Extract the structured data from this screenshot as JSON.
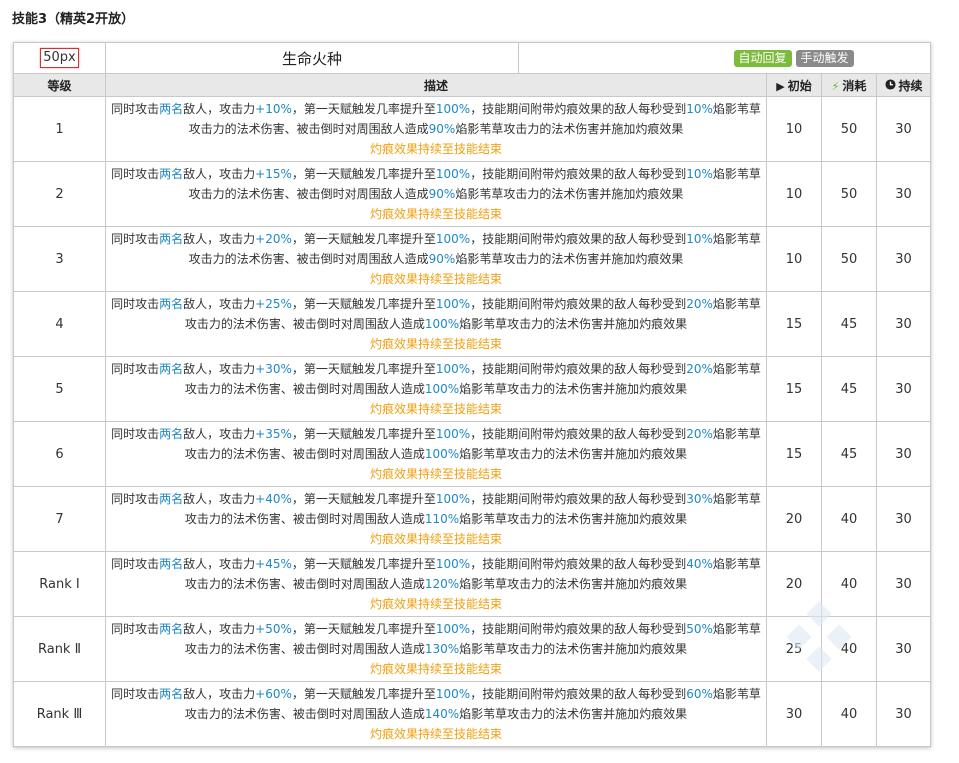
{
  "section_title": "技能3（精英2开放）",
  "skill": {
    "icon_placeholder": "50px",
    "name": "生命火种",
    "tags": [
      "自动回复",
      "手动触发"
    ]
  },
  "columns": {
    "level": "等级",
    "desc": "描述",
    "initial": "初始",
    "cost": "消耗",
    "duration": "持续"
  },
  "icons": {
    "initial": "play-icon",
    "cost": "lightning-icon",
    "duration": "clock-icon"
  },
  "colors": {
    "highlight_blue": "#1e88c8",
    "highlight_orange": "#f0a010",
    "tag_green": "#7dbb3c",
    "tag_gray": "#8a8a8a"
  },
  "desc_text": {
    "a": "同时攻击",
    "targets": "两名",
    "b": "敌人，攻击力",
    "c": "，第一天赋触发几率提升至",
    "prob": "100%",
    "d": "，技能期间附带灼痕效果的敌人每秒受到",
    "e": "焰影苇草攻击力的法术伤害、被击倒时对周围敌人造成",
    "f": "焰影苇草攻击力的法术伤害并施加灼痕效果",
    "line3": "灼痕效果持续至技能结束"
  },
  "rows": [
    {
      "level": "1",
      "atk": "+10%",
      "burn": "10%",
      "splash": "90%",
      "initial": "10",
      "cost": "50",
      "duration": "30"
    },
    {
      "level": "2",
      "atk": "+15%",
      "burn": "10%",
      "splash": "90%",
      "initial": "10",
      "cost": "50",
      "duration": "30"
    },
    {
      "level": "3",
      "atk": "+20%",
      "burn": "10%",
      "splash": "90%",
      "initial": "10",
      "cost": "50",
      "duration": "30"
    },
    {
      "level": "4",
      "atk": "+25%",
      "burn": "20%",
      "splash": "100%",
      "initial": "15",
      "cost": "45",
      "duration": "30"
    },
    {
      "level": "5",
      "atk": "+30%",
      "burn": "20%",
      "splash": "100%",
      "initial": "15",
      "cost": "45",
      "duration": "30"
    },
    {
      "level": "6",
      "atk": "+35%",
      "burn": "20%",
      "splash": "100%",
      "initial": "15",
      "cost": "45",
      "duration": "30"
    },
    {
      "level": "7",
      "atk": "+40%",
      "burn": "30%",
      "splash": "110%",
      "initial": "20",
      "cost": "40",
      "duration": "30"
    },
    {
      "level": "Rank Ⅰ",
      "atk": "+45%",
      "burn": "40%",
      "splash": "120%",
      "initial": "20",
      "cost": "40",
      "duration": "30"
    },
    {
      "level": "Rank Ⅱ",
      "atk": "+50%",
      "burn": "50%",
      "splash": "130%",
      "initial": "25",
      "cost": "40",
      "duration": "30"
    },
    {
      "level": "Rank Ⅲ",
      "atk": "+60%",
      "burn": "60%",
      "splash": "140%",
      "initial": "30",
      "cost": "40",
      "duration": "30"
    }
  ]
}
